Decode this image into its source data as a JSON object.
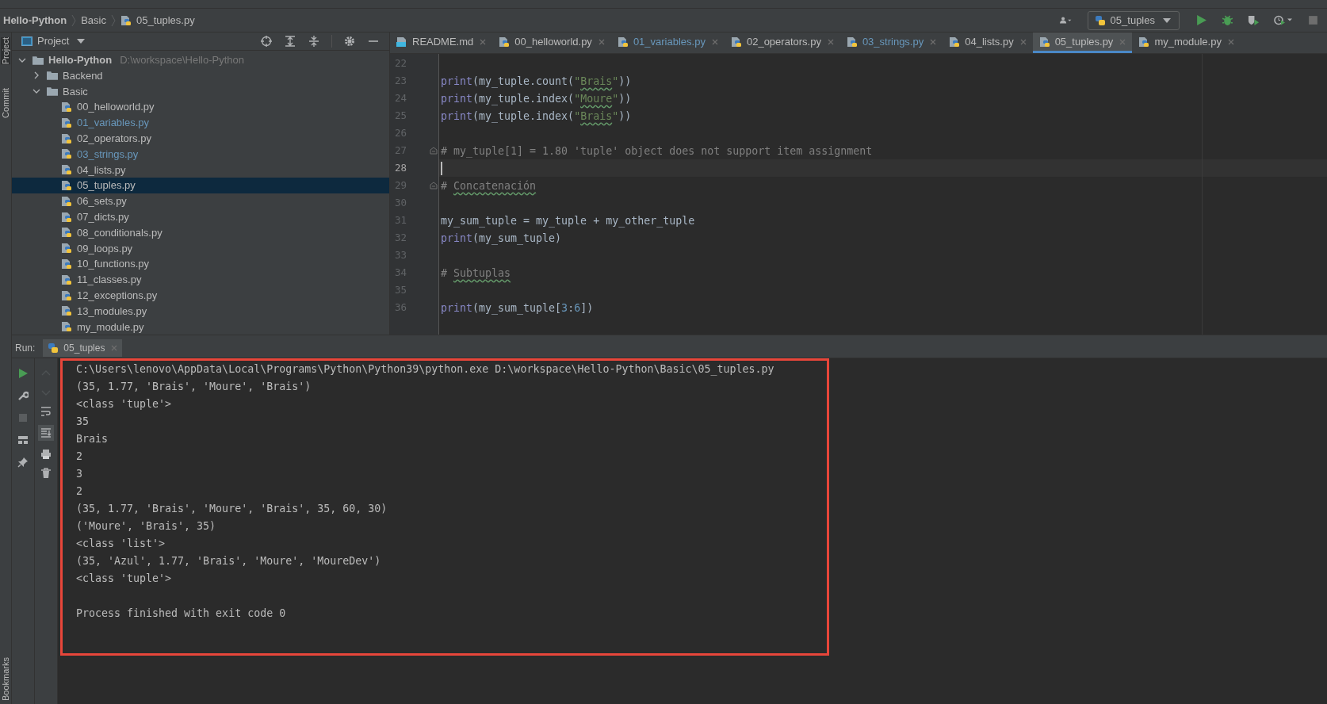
{
  "side_strip": {
    "top": [
      {
        "label": "Project",
        "selected": true
      },
      {
        "label": "Commit",
        "selected": false
      }
    ],
    "bottom": {
      "label": "Bookmarks",
      "selected": false
    }
  },
  "breadcrumb": [
    {
      "label": "Hello-Python",
      "kind": "project"
    },
    {
      "label": "Basic",
      "kind": "folder"
    },
    {
      "label": "05_tuples.py",
      "kind": "python"
    }
  ],
  "toolbar": {
    "run_config": "05_tuples"
  },
  "project_panel": {
    "title": "Project",
    "tree": [
      {
        "name": "Hello-Python",
        "path": "D:\\workspace\\Hello-Python",
        "kind": "folder",
        "expanded": true,
        "selected": false,
        "color": "#bbbbbb",
        "children": [
          {
            "name": "Backend",
            "kind": "folder",
            "expanded": false,
            "selected": false,
            "color": "#bbbbbb"
          },
          {
            "name": "Basic",
            "kind": "folder",
            "expanded": true,
            "selected": false,
            "color": "#bbbbbb",
            "children": [
              {
                "name": "00_helloworld.py",
                "kind": "python",
                "selected": false,
                "color": "#bbbbbb"
              },
              {
                "name": "01_variables.py",
                "kind": "python",
                "selected": false,
                "color": "#6897bb"
              },
              {
                "name": "02_operators.py",
                "kind": "python",
                "selected": false,
                "color": "#bbbbbb"
              },
              {
                "name": "03_strings.py",
                "kind": "python",
                "selected": false,
                "color": "#6897bb"
              },
              {
                "name": "04_lists.py",
                "kind": "python",
                "selected": false,
                "color": "#bbbbbb"
              },
              {
                "name": "05_tuples.py",
                "kind": "python",
                "selected": true,
                "color": "#bbbbbb"
              },
              {
                "name": "06_sets.py",
                "kind": "python",
                "selected": false,
                "color": "#bbbbbb"
              },
              {
                "name": "07_dicts.py",
                "kind": "python",
                "selected": false,
                "color": "#bbbbbb"
              },
              {
                "name": "08_conditionals.py",
                "kind": "python",
                "selected": false,
                "color": "#bbbbbb"
              },
              {
                "name": "09_loops.py",
                "kind": "python",
                "selected": false,
                "color": "#bbbbbb"
              },
              {
                "name": "10_functions.py",
                "kind": "python",
                "selected": false,
                "color": "#bbbbbb"
              },
              {
                "name": "11_classes.py",
                "kind": "python",
                "selected": false,
                "color": "#bbbbbb"
              },
              {
                "name": "12_exceptions.py",
                "kind": "python",
                "selected": false,
                "color": "#bbbbbb"
              },
              {
                "name": "13_modules.py",
                "kind": "python",
                "selected": false,
                "color": "#bbbbbb"
              },
              {
                "name": "my_module.py",
                "kind": "python",
                "selected": false,
                "color": "#bbbbbb"
              }
            ]
          }
        ]
      }
    ]
  },
  "editor_tabs": [
    {
      "label": "README.md",
      "kind": "markdown",
      "selected": false,
      "color": "#bbbbbb"
    },
    {
      "label": "00_helloworld.py",
      "kind": "python",
      "selected": false,
      "color": "#bbbbbb"
    },
    {
      "label": "01_variables.py",
      "kind": "python",
      "selected": false,
      "color": "#6897bb"
    },
    {
      "label": "02_operators.py",
      "kind": "python",
      "selected": false,
      "color": "#bbbbbb"
    },
    {
      "label": "03_strings.py",
      "kind": "python",
      "selected": false,
      "color": "#6897bb"
    },
    {
      "label": "04_lists.py",
      "kind": "python",
      "selected": false,
      "color": "#bbbbbb"
    },
    {
      "label": "05_tuples.py",
      "kind": "python",
      "selected": true,
      "color": "#bbbbbb"
    },
    {
      "label": "my_module.py",
      "kind": "python",
      "selected": false,
      "color": "#bbbbbb"
    }
  ],
  "code": [
    {
      "number": "22",
      "current": false,
      "fold": false
    },
    {
      "number": "23",
      "current": false,
      "fold": false,
      "tokens": [
        {
          "text": "print",
          "kind": "builtin"
        },
        {
          "text": "(my_tuple.count(",
          "kind": "plain"
        },
        {
          "text": "\"",
          "kind": "string"
        },
        {
          "text": "Brais",
          "kind": "typo-string"
        },
        {
          "text": "\"",
          "kind": "string"
        },
        {
          "text": "))",
          "kind": "plain"
        }
      ]
    },
    {
      "number": "24",
      "current": false,
      "fold": false,
      "tokens": [
        {
          "text": "print",
          "kind": "builtin"
        },
        {
          "text": "(my_tuple.index(",
          "kind": "plain"
        },
        {
          "text": "\"",
          "kind": "string"
        },
        {
          "text": "Moure",
          "kind": "typo-string"
        },
        {
          "text": "\"",
          "kind": "string"
        },
        {
          "text": "))",
          "kind": "plain"
        }
      ]
    },
    {
      "number": "25",
      "current": false,
      "fold": false,
      "tokens": [
        {
          "text": "print",
          "kind": "builtin"
        },
        {
          "text": "(my_tuple.index(",
          "kind": "plain"
        },
        {
          "text": "\"",
          "kind": "string"
        },
        {
          "text": "Brais",
          "kind": "typo-string"
        },
        {
          "text": "\"",
          "kind": "string"
        },
        {
          "text": "))",
          "kind": "plain"
        }
      ]
    },
    {
      "number": "26",
      "current": false,
      "fold": false
    },
    {
      "number": "27",
      "current": false,
      "fold": true,
      "tokens": [
        {
          "text": "# my_tuple[1] = 1.80 'tuple' object does not support item assignment",
          "kind": "comment"
        }
      ]
    },
    {
      "number": "28",
      "current": true,
      "fold": false
    },
    {
      "number": "29",
      "current": false,
      "fold": true,
      "tokens": [
        {
          "text": "# ",
          "kind": "comment"
        },
        {
          "text": "Concatenación",
          "kind": "typo-comment"
        }
      ]
    },
    {
      "number": "30",
      "current": false,
      "fold": false
    },
    {
      "number": "31",
      "current": false,
      "fold": false,
      "tokens": [
        {
          "text": "my_sum_tuple = my_tuple + my_other_tuple",
          "kind": "plain"
        }
      ]
    },
    {
      "number": "32",
      "current": false,
      "fold": false,
      "tokens": [
        {
          "text": "print",
          "kind": "builtin"
        },
        {
          "text": "(my_sum_tuple)",
          "kind": "plain"
        }
      ]
    },
    {
      "number": "33",
      "current": false,
      "fold": false
    },
    {
      "number": "34",
      "current": false,
      "fold": false,
      "tokens": [
        {
          "text": "# ",
          "kind": "comment"
        },
        {
          "text": "Subtuplas",
          "kind": "typo-comment"
        }
      ]
    },
    {
      "number": "35",
      "current": false,
      "fold": false
    },
    {
      "number": "36",
      "current": false,
      "fold": false,
      "tokens": [
        {
          "text": "print",
          "kind": "builtin"
        },
        {
          "text": "(my_sum_tuple[",
          "kind": "plain"
        },
        {
          "text": "3",
          "kind": "number"
        },
        {
          "text": ":",
          "kind": "plain"
        },
        {
          "text": "6",
          "kind": "number"
        },
        {
          "text": "])",
          "kind": "plain"
        }
      ]
    }
  ],
  "run_panel": {
    "label": "Run:",
    "tab": "05_tuples",
    "output": [
      "C:\\Users\\lenovo\\AppData\\Local\\Programs\\Python\\Python39\\python.exe D:\\workspace\\Hello-Python\\Basic\\05_tuples.py",
      "(35, 1.77, 'Brais', 'Moure', 'Brais')",
      "<class 'tuple'>",
      "35",
      "Brais",
      "2",
      "3",
      "2",
      "(35, 1.77, 'Brais', 'Moure', 'Brais', 35, 60, 30)",
      "('Moure', 'Brais', 35)",
      "<class 'list'>",
      "(35, 'Azul', 1.77, 'Brais', 'Moure', 'MoureDev')",
      "<class 'tuple'>"
    ],
    "exit_message": "Process finished with exit code 0"
  }
}
